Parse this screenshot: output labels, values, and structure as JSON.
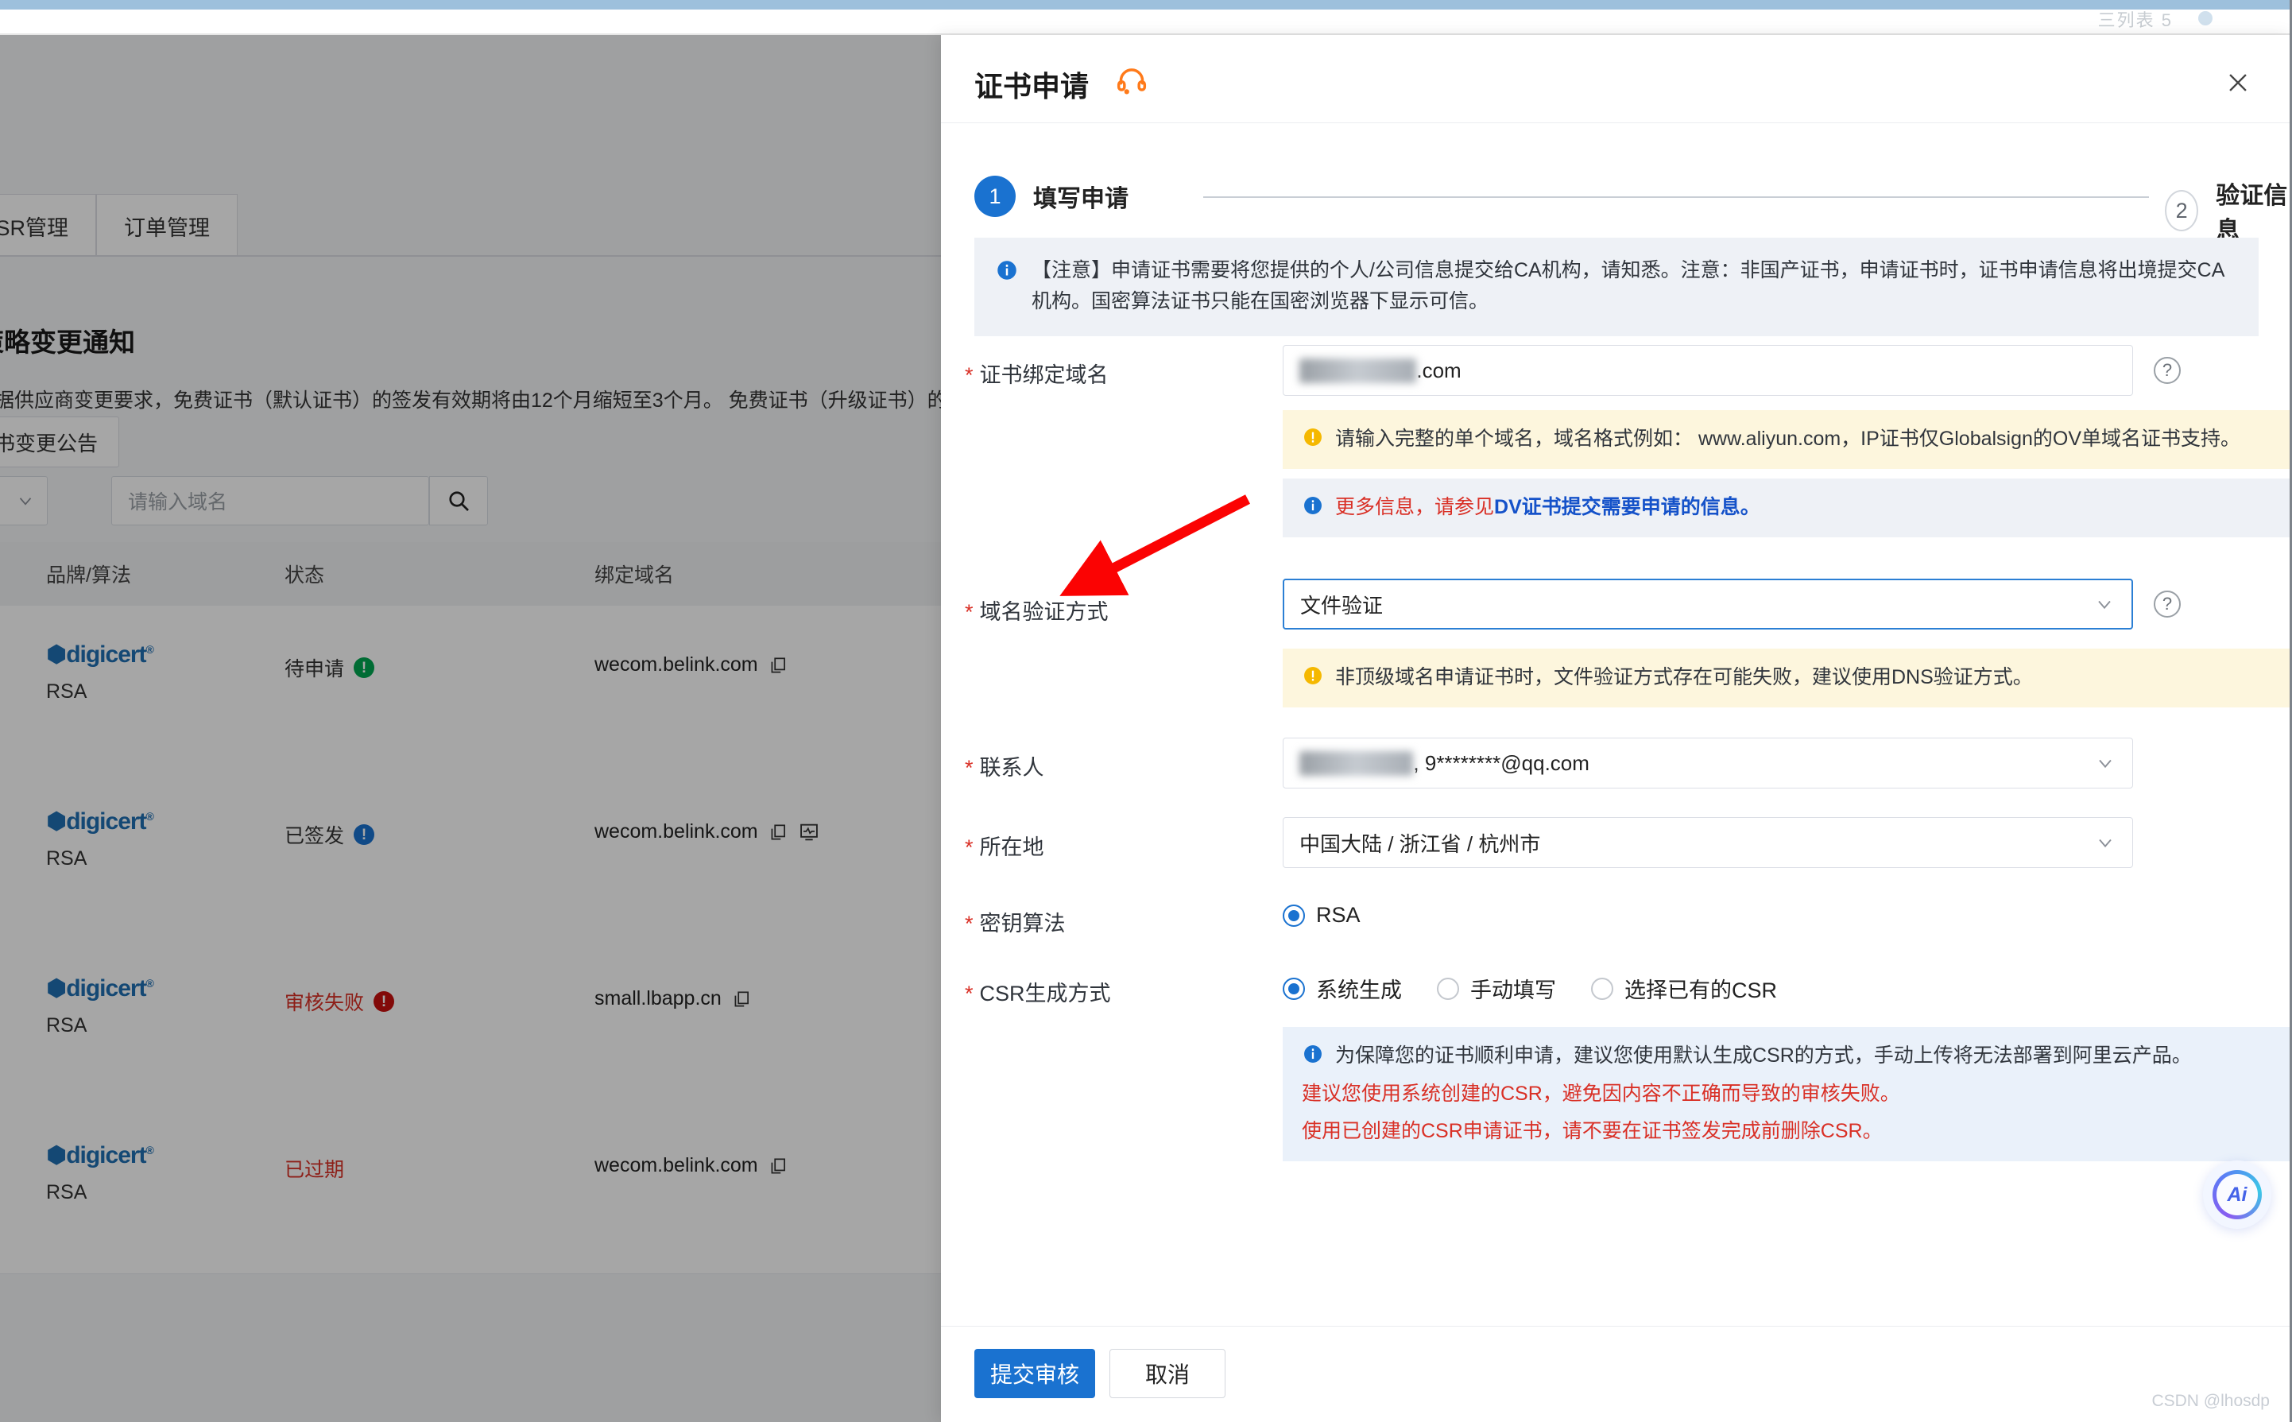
{
  "browser": {
    "ghost_text": "三列表 5"
  },
  "background_page": {
    "tabs": [
      {
        "label": "CSR管理"
      },
      {
        "label": "订单管理"
      }
    ],
    "notice": {
      "title": "策略变更通知",
      "body": "根据供应商变更要求，免费证书（默认证书）的签发有效期将由12个月缩短至3个月。 免费证书（升级证书）的有效",
      "button_label": "证书变更公告"
    },
    "search": {
      "placeholder": "请输入域名",
      "filter_value": "",
      "search_icon": "search-icon"
    },
    "table": {
      "columns": [
        "品牌/算法",
        "状态",
        "绑定域名"
      ],
      "rows": [
        {
          "brand": "digicert",
          "algorithm": "RSA",
          "status": "待申请",
          "status_color": "#333333",
          "badge_color": "#00a650",
          "badge_glyph": "!",
          "domain": "wecom.belink.com",
          "has_monitor_icon": false
        },
        {
          "brand": "digicert",
          "algorithm": "RSA",
          "status": "已签发",
          "status_color": "#333333",
          "badge_color": "#1a72d0",
          "badge_glyph": "!",
          "domain": "wecom.belink.com",
          "has_monitor_icon": true
        },
        {
          "brand": "digicert",
          "algorithm": "RSA",
          "status": "审核失败",
          "status_color": "#d93026",
          "badge_color": "#c8100f",
          "badge_glyph": "!",
          "domain": "small.lbapp.cn",
          "has_monitor_icon": false
        },
        {
          "brand": "digicert",
          "algorithm": "RSA",
          "status": "已过期",
          "status_color": "#d93026",
          "badge_color": "",
          "badge_glyph": "",
          "domain": "wecom.belink.com",
          "has_monitor_icon": false
        }
      ]
    }
  },
  "drawer": {
    "title": "证书申请",
    "headset_icon": "headset-icon",
    "close_icon": "close-icon",
    "steps": [
      {
        "num": "1",
        "label": "填写申请",
        "state": "active"
      },
      {
        "num": "2",
        "label": "验证信息",
        "state": "idle"
      }
    ],
    "notice": "【注意】申请证书需要将您提供的个人/公司信息提交给CA机构，请知悉。注意：非国产证书，申请证书时，证书申请信息将出境提交CA机构。国密算法证书只能在国密浏览器下显示可信。",
    "fields": {
      "domain": {
        "label": "证书绑定域名",
        "value": ".com",
        "value_masked": "████████",
        "help_icon": "question-icon",
        "warn": "请输入完整的单个域名，域名格式例如： www.aliyun.com，IP证书仅Globalsign的OV单域名证书支持。",
        "info_prefix": "更多信息，请参见",
        "info_link": "DV证书提交需要申请的信息。"
      },
      "validation": {
        "label": "域名验证方式",
        "value": "文件验证",
        "help_icon": "question-icon",
        "chevron_icon": "chevron-down-icon",
        "warn": "非顶级域名申请证书时，文件验证方式存在可能失败，建议使用DNS验证方式。"
      },
      "contact": {
        "label": "联系人",
        "value_masked": "███ ██ ██",
        "value": ", 9********@qq.com",
        "chevron_icon": "chevron-down-icon"
      },
      "location": {
        "label": "所在地",
        "value": "中国大陆 / 浙江省 / 杭州市",
        "chevron_icon": "chevron-down-icon"
      },
      "key_algorithm": {
        "label": "密钥算法",
        "options": [
          {
            "label": "RSA",
            "selected": true
          }
        ]
      },
      "csr": {
        "label": "CSR生成方式",
        "options": [
          {
            "label": "系统生成",
            "selected": true
          },
          {
            "label": "手动填写",
            "selected": false
          },
          {
            "label": "选择已有的CSR",
            "selected": false
          }
        ],
        "tip_info": "为保障您的证书顺利申请，建议您使用默认生成CSR的方式，手动上传将无法部署到阿里云产品。",
        "tip_red_1": "建议您使用系统创建的CSR，避免因内容不正确而导致的审核失败。",
        "tip_red_2": "使用已创建的CSR申请证书，请不要在证书签发完成前删除CSR。"
      }
    },
    "footer": {
      "submit_label": "提交审核",
      "cancel_label": "取消"
    }
  },
  "overlays": {
    "annotation_arrow": "red-arrow-annotation",
    "ai_button": {
      "label": "Ai",
      "icon": "ai-assistant-icon"
    },
    "watermark": "CSDN @lhosdp"
  },
  "colors": {
    "primary": "#1a72d0",
    "danger": "#d93026",
    "warn_bg": "#fdf6dd",
    "info_bg": "#eef1f6"
  }
}
